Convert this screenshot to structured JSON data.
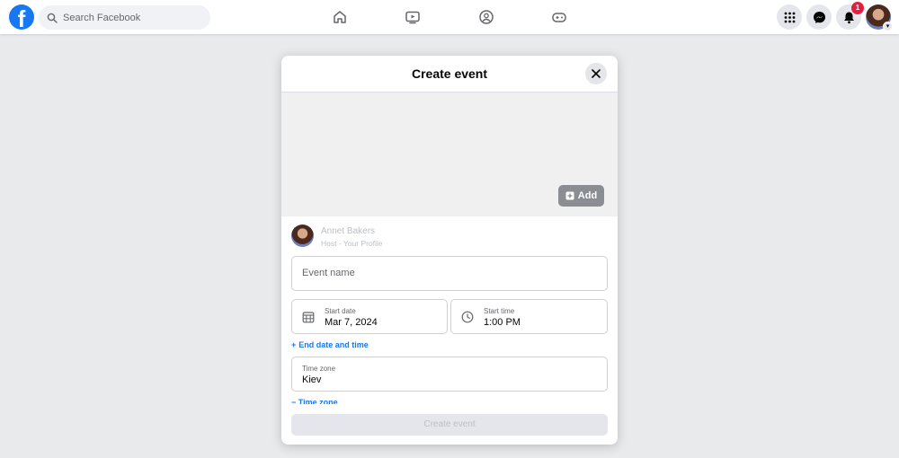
{
  "topbar": {
    "logo_letter": "f",
    "search_placeholder": "Search Facebook",
    "notification_count": "1",
    "icons": [
      "home-icon",
      "watch-icon",
      "groups-icon",
      "gaming-icon",
      "menu-grid-icon",
      "messenger-icon",
      "bell-icon"
    ]
  },
  "modal": {
    "title": "Create event",
    "add_label": "Add",
    "host_name": "Annet Bakers",
    "host_sub": "Host - Your Profile",
    "event_name_placeholder": "Event name",
    "start_date_label": "Start date",
    "start_date_value": "Mar 7, 2024",
    "start_time_label": "Start time",
    "start_time_value": "1:00 PM",
    "end_link_label": "End date and time",
    "end_link_plus": "+",
    "timezone_label": "Time zone",
    "timezone_value": "Kiev",
    "timezone_link_label": "− Time zone",
    "create_button_label": "Create event"
  },
  "colors": {
    "brand": "#1877f2",
    "badge": "#e41e3f",
    "background": "#e9eaec"
  }
}
